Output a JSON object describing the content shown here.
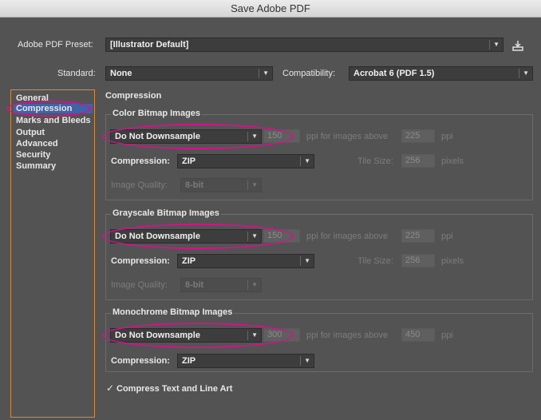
{
  "window": {
    "title": "Save Adobe PDF"
  },
  "preset": {
    "label": "Adobe PDF Preset:",
    "value": "[Illustrator Default]"
  },
  "standard": {
    "label": "Standard:",
    "value": "None"
  },
  "compatibility": {
    "label": "Compatibility:",
    "value": "Acrobat 6 (PDF 1.5)"
  },
  "sidebar": {
    "items": [
      {
        "label": "General"
      },
      {
        "label": "Compression"
      },
      {
        "label": "Marks and Bleeds"
      },
      {
        "label": "Output"
      },
      {
        "label": "Advanced"
      },
      {
        "label": "Security"
      },
      {
        "label": "Summary"
      }
    ],
    "selected_index": 1
  },
  "panel": {
    "title": "Compression"
  },
  "color": {
    "group_title": "Color Bitmap Images",
    "downsample": "Do Not Downsample",
    "ppi": "150",
    "ppi_label": "ppi for images above",
    "above": "225",
    "ppi_unit": "ppi",
    "compression_label": "Compression:",
    "compression": "ZIP",
    "tile_label": "Tile Size:",
    "tile": "256",
    "tile_unit": "pixels",
    "quality_label": "Image Quality:",
    "quality": "8-bit"
  },
  "grayscale": {
    "group_title": "Grayscale Bitmap Images",
    "downsample": "Do Not Downsample",
    "ppi": "150",
    "ppi_label": "ppi for images above",
    "above": "225",
    "ppi_unit": "ppi",
    "compression_label": "Compression:",
    "compression": "ZIP",
    "tile_label": "Tile Size:",
    "tile": "256",
    "tile_unit": "pixels",
    "quality_label": "Image Quality:",
    "quality": "8-bit"
  },
  "monochrome": {
    "group_title": "Monochrome Bitmap Images",
    "downsample": "Do Not Downsample",
    "ppi": "300",
    "ppi_label": "ppi for images above",
    "above": "450",
    "ppi_unit": "ppi",
    "compression_label": "Compression:",
    "compression": "ZIP"
  },
  "compress_text": {
    "label": "Compress Text and Line Art",
    "checked": true
  },
  "colors": {
    "highlight": "#d0148a",
    "sidebar_border": "#d88a3a",
    "selection": "#3e63a8",
    "background": "#535353"
  }
}
